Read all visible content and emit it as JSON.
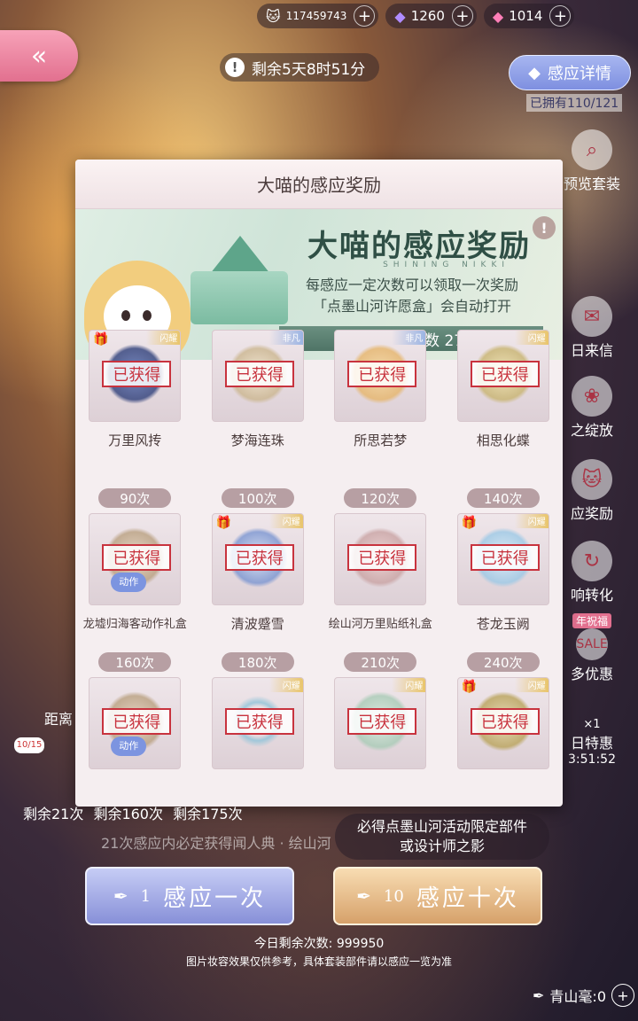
{
  "currency": {
    "coins": "117459743",
    "diamonds_purple": "1260",
    "diamonds_pink": "1014"
  },
  "header": {
    "timer": "剩余5天8时51分",
    "detail_button": "感应详情",
    "owned": "已拥有110/121"
  },
  "side_menu": [
    {
      "label": "预览套装",
      "icon": "magnifier-icon"
    },
    {
      "label": "日来信",
      "icon": "letter-icon"
    },
    {
      "label": "之绽放",
      "icon": "flower-icon"
    },
    {
      "label": "应奖励",
      "icon": "cat-reward-icon"
    },
    {
      "label": "响转化",
      "icon": "swirl-icon"
    },
    {
      "label": "多优惠",
      "icon": "sale-icon",
      "badge": "年祝福"
    },
    {
      "label": "日特惠",
      "icon": "pen-icon",
      "timer": "3:51:52",
      "mult": "×1"
    }
  ],
  "modal": {
    "title": "大喵的感应奖励",
    "banner_title": "大喵的感应奖励",
    "banner_en": "SHINING NIKKI",
    "desc_line1": "每感应一定次数可以领取一次奖励",
    "desc_line2": "「点墨山河许愿盒」会自动打开",
    "count_text": "当前感应次数 270",
    "rows": [
      [
        {
          "name": "万里风抟",
          "count": "",
          "status": "已获得",
          "tag": "闪耀"
        },
        {
          "name": "梦海连珠",
          "count": "",
          "status": "已获得",
          "tag": "非凡"
        },
        {
          "name": "所思若梦",
          "count": "",
          "status": "已获得",
          "tag": "非凡"
        },
        {
          "name": "相思化蝶",
          "count": "",
          "status": "已获得",
          "tag": "闪耀"
        }
      ],
      [
        {
          "name": "龙墟归海客动作礼盒",
          "count": "90次",
          "status": "已获得",
          "tag": "",
          "overlay": "动作"
        },
        {
          "name": "清波蹙雪",
          "count": "100次",
          "status": "已获得",
          "tag": "闪耀"
        },
        {
          "name": "绘山河万里贴纸礼盒",
          "count": "120次",
          "status": "已获得",
          "tag": ""
        },
        {
          "name": "苍龙玉阙",
          "count": "140次",
          "status": "已获得",
          "tag": "闪耀"
        }
      ],
      [
        {
          "name": "",
          "count": "160次",
          "status": "已获得",
          "tag": "",
          "overlay": "动作"
        },
        {
          "name": "",
          "count": "180次",
          "status": "已获得",
          "tag": "闪耀"
        },
        {
          "name": "",
          "count": "210次",
          "status": "已获得",
          "tag": "闪耀"
        },
        {
          "name": "",
          "count": "240次",
          "status": "已获得",
          "tag": "闪耀"
        }
      ]
    ]
  },
  "bottom": {
    "left_label": "距离",
    "badge": "10/15",
    "remain_row": "剩余21次 剩余160次 剩余175次",
    "hint_line": "21次感应内必定获得闻人典 · 绘山河",
    "guarantee_line1": "必得点墨山河活动限定部件",
    "guarantee_line2": "或设计师之影",
    "draw_one_count": "1",
    "draw_one_label": "感应一次",
    "draw_ten_count": "10",
    "draw_ten_label": "感应十次",
    "today_remaining": "今日剩余次数: 999950",
    "disclaimer": "图片妆容效果仅供参考，具体套装部件请以感应一览为准",
    "brush_balance": "青山毫:0"
  },
  "colors": {
    "accent_pink": "#e2708f",
    "accent_blue": "#8790d8",
    "accent_gold": "#d6a16a",
    "stamp_red": "#c8333e",
    "banner_green": "#4f7466"
  }
}
